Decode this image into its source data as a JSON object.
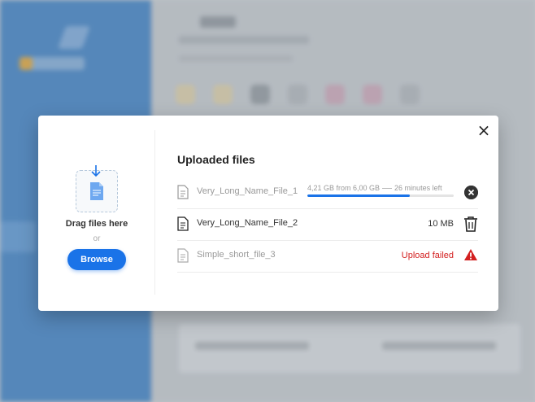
{
  "modal": {
    "close_label": "×",
    "dropzone": {
      "drag_label": "Drag files here",
      "or_label": "or",
      "browse_label": "Browse"
    },
    "files_title": "Uploaded files",
    "files": [
      {
        "name": "Very_Long_Name_File_1",
        "state": "uploading",
        "progress_label": "4,21 GB from 6,00 GB",
        "time_left": "26 minutes left",
        "progress": 0.7
      },
      {
        "name": "Very_Long_Name_File_2",
        "state": "done",
        "size": "10 MB"
      },
      {
        "name": "Simple_short_file_3",
        "state": "failed",
        "status": "Upload failed"
      }
    ]
  },
  "colors": {
    "accent": "#1a73e8",
    "error": "#d32020",
    "sidebar": "#3f7fc0"
  },
  "icons": {
    "close": "close-icon",
    "upload_arrow": "arrow-down-icon",
    "document": "document-icon",
    "cancel": "cancel-circle-icon",
    "trash": "trash-icon",
    "warning": "warning-icon"
  }
}
